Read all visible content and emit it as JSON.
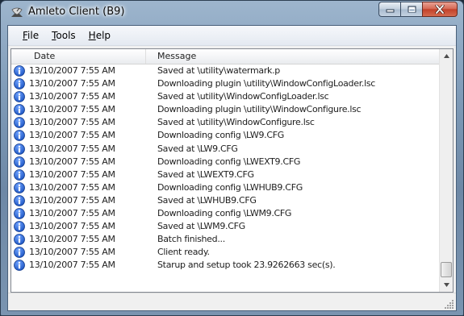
{
  "window": {
    "title": "Amleto Client (B9)"
  },
  "menu": {
    "file": {
      "mnemonic": "F",
      "rest": "ile"
    },
    "tools": {
      "mnemonic": "T",
      "rest": "ools"
    },
    "help": {
      "mnemonic": "H",
      "rest": "elp"
    }
  },
  "list": {
    "columns": {
      "date": "Date",
      "message": "Message"
    },
    "rows": [
      {
        "date": "13/10/2007 7:55 AM",
        "message": "Saved at \\utility\\watermark.p"
      },
      {
        "date": "13/10/2007 7:55 AM",
        "message": "Downloading plugin \\utility\\WindowConfigLoader.lsc"
      },
      {
        "date": "13/10/2007 7:55 AM",
        "message": "Saved at \\utility\\WindowConfigLoader.lsc"
      },
      {
        "date": "13/10/2007 7:55 AM",
        "message": "Downloading plugin \\utility\\WindowConfigure.lsc"
      },
      {
        "date": "13/10/2007 7:55 AM",
        "message": "Saved at \\utility\\WindowConfigure.lsc"
      },
      {
        "date": "13/10/2007 7:55 AM",
        "message": "Downloading config \\LW9.CFG"
      },
      {
        "date": "13/10/2007 7:55 AM",
        "message": "Saved at \\LW9.CFG"
      },
      {
        "date": "13/10/2007 7:55 AM",
        "message": "Downloading config \\LWEXT9.CFG"
      },
      {
        "date": "13/10/2007 7:55 AM",
        "message": "Saved at \\LWEXT9.CFG"
      },
      {
        "date": "13/10/2007 7:55 AM",
        "message": "Downloading config \\LWHUB9.CFG"
      },
      {
        "date": "13/10/2007 7:55 AM",
        "message": "Saved at \\LWHUB9.CFG"
      },
      {
        "date": "13/10/2007 7:55 AM",
        "message": "Downloading config \\LWM9.CFG"
      },
      {
        "date": "13/10/2007 7:55 AM",
        "message": "Saved at \\LWM9.CFG"
      },
      {
        "date": "13/10/2007 7:55 AM",
        "message": "Batch finished..."
      },
      {
        "date": "13/10/2007 7:55 AM",
        "message": "Client ready."
      },
      {
        "date": "13/10/2007 7:55 AM",
        "message": "Starup and setup took 23.9262663 sec(s)."
      }
    ],
    "row_icon": "info-icon"
  },
  "colors": {
    "info_icon": "#1f57c4",
    "close_button": "#c2412a"
  },
  "icons": {
    "app": "satellite-dish-icon",
    "minimize": "minimize-icon",
    "maximize": "maximize-icon",
    "close": "close-icon",
    "scroll_up": "chevron-up-icon",
    "scroll_down": "chevron-down-icon",
    "resize": "resize-grip-icon"
  }
}
